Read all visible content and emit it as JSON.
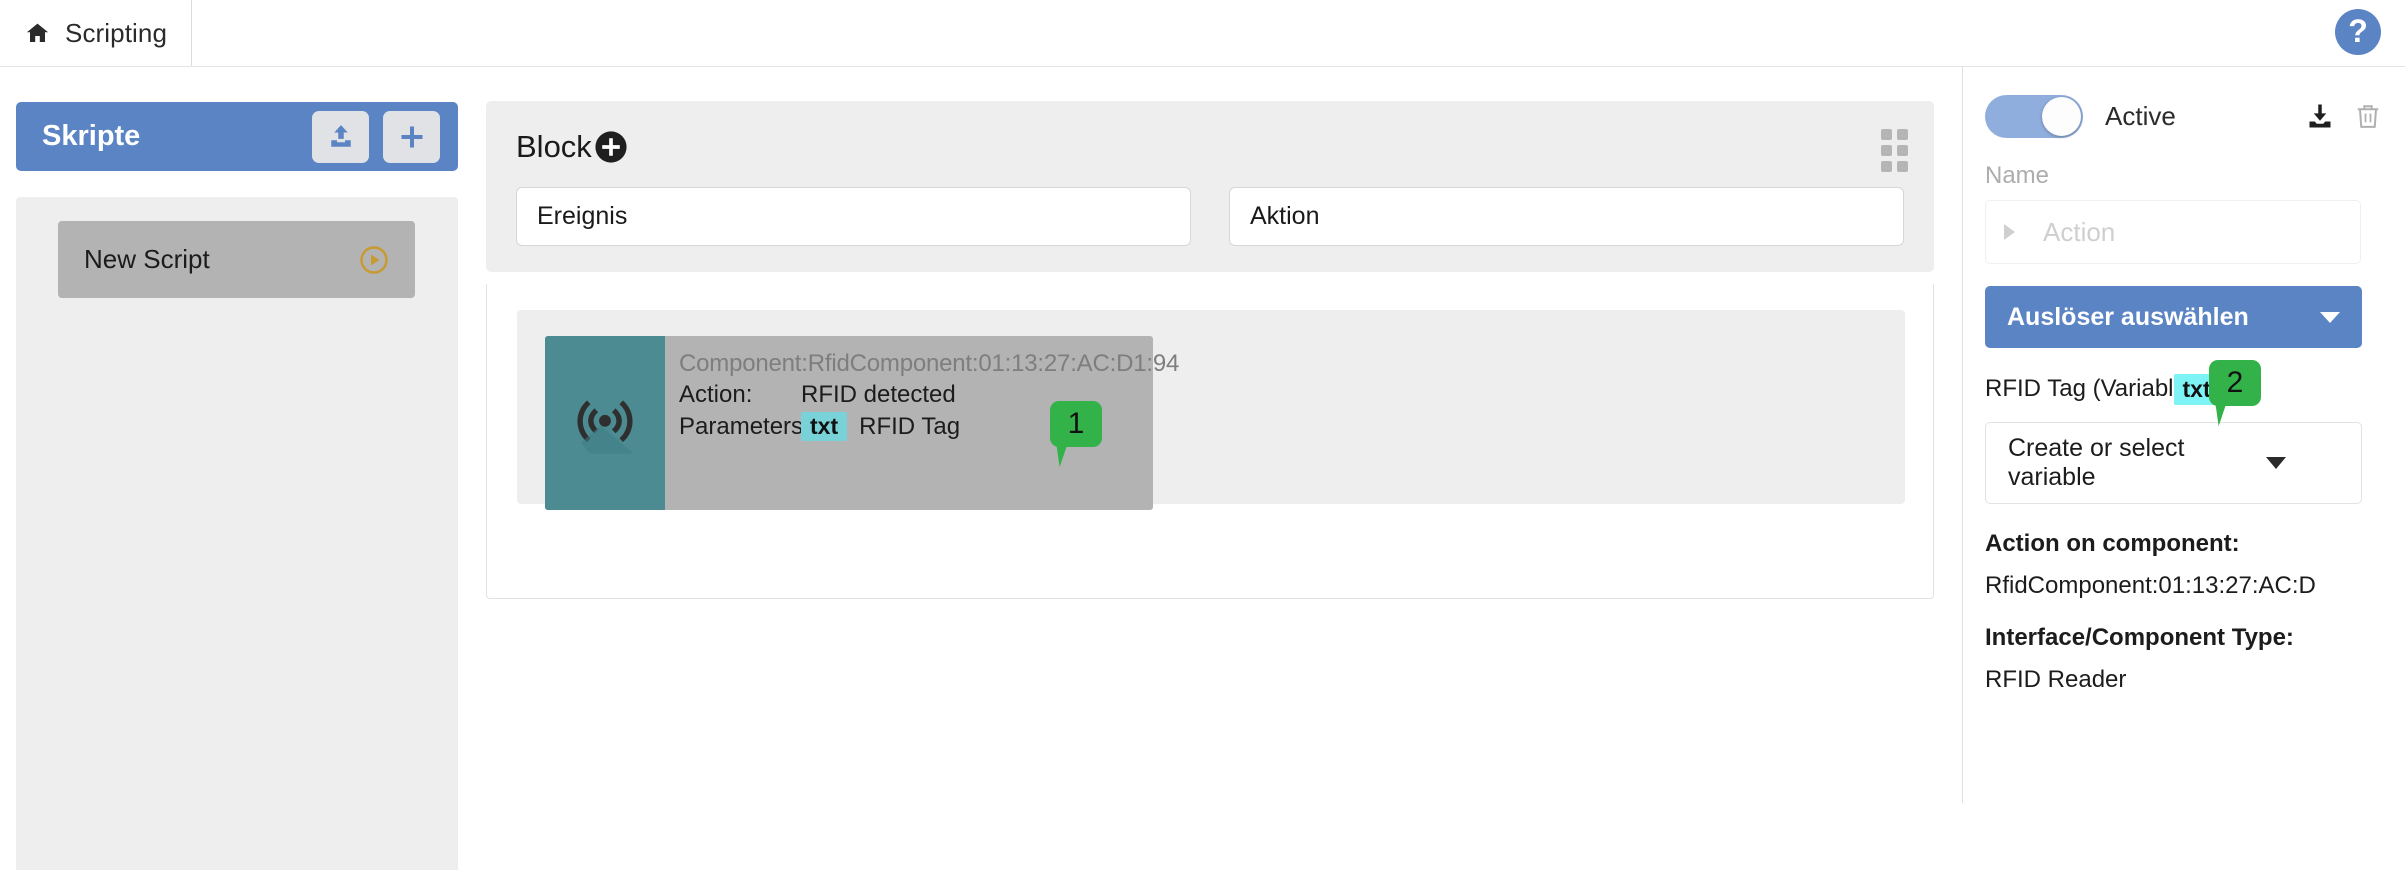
{
  "topbar": {
    "home_icon": "home-icon",
    "brand": "Scripting",
    "help_icon": "?"
  },
  "sidebar": {
    "header_title": "Skripte",
    "upload_icon": "upload-icon",
    "add_icon": "plus-icon",
    "scripts": [
      {
        "name": "New Script",
        "run_icon": "play-circle-icon"
      }
    ]
  },
  "canvas": {
    "block": {
      "title": "Block",
      "add_icon": "plus-circle-icon",
      "drag_handle_icon": "grid-dots-icon",
      "slots": [
        {
          "label": "Ereignis"
        },
        {
          "label": "Aktion"
        }
      ]
    },
    "component_card": {
      "icon": "rfid-signal-icon",
      "identifier": "Component:RfidComponent:01:13:27:AC:D1:94",
      "action_label": "Action:",
      "action_value": "RFID detected",
      "parameters_label": "Parameters:",
      "parameter_badge": "txt",
      "parameter_name": "RFID Tag",
      "callout": "1"
    }
  },
  "rightpanel": {
    "toggle_state_label": "Active",
    "download_icon": "download-icon",
    "delete_icon": "trash-icon",
    "name_label": "Name",
    "action_placeholder": "Action",
    "expand_icon": "triangle-right-icon",
    "trigger_button": "Auslöser auswählen",
    "trigger_chevron_icon": "chevron-down-icon",
    "variable_label": "RFID Tag (Variabl",
    "variable_badge": "txt",
    "variable_callout": "2",
    "variable_select_value": "Create or select variable",
    "variable_select_chevron_icon": "chevron-down-icon",
    "info": [
      {
        "title": "Action on component:",
        "value": "RfidComponent:01:13:27:AC:D"
      },
      {
        "title": "Interface/Component Type:",
        "value": "RFID Reader"
      }
    ]
  },
  "colors": {
    "accent_blue": "#5b84c4",
    "teal": "#4b8b91",
    "callout_green": "#33b249",
    "badge_cyan": "#79d2d8",
    "run_gold": "#c79a32"
  }
}
